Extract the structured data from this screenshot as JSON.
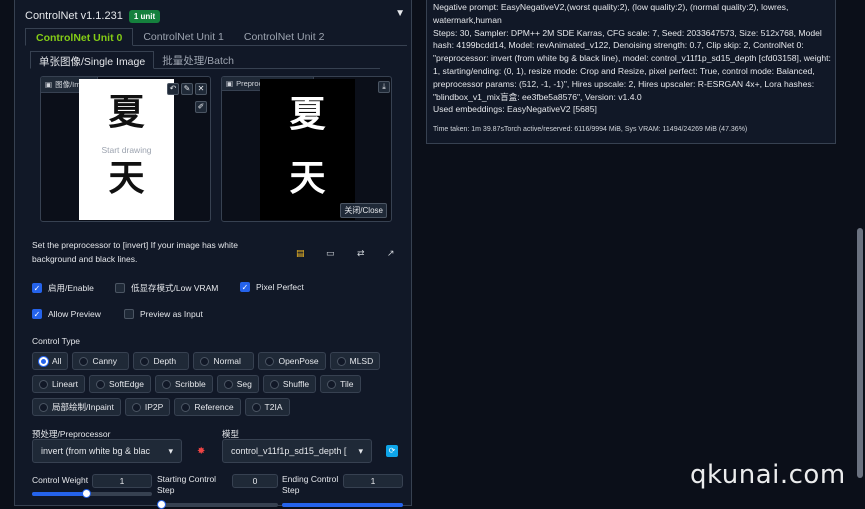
{
  "accordion": {
    "title": "ControlNet v1.1.231",
    "badge": "1 unit",
    "caret": "▼"
  },
  "unit_tabs": [
    "ControlNet Unit 0",
    "ControlNet Unit 1",
    "ControlNet Unit 2"
  ],
  "sub_tabs": [
    "单张图像/Single Image",
    "批量处理/Batch"
  ],
  "image_panel": {
    "label": "图像/Image",
    "overlay_text": "Start drawing",
    "char1": "夏",
    "char2": "天"
  },
  "preview_panel": {
    "label": "Preprocessor Preview",
    "close_label": "关闭/Close",
    "char1": "夏",
    "char2": "天"
  },
  "hint": "Set the preprocessor to [invert] If your image has white background and black lines.",
  "checks_row1": [
    {
      "label": "启用/Enable",
      "checked": true
    },
    {
      "label": "低显存模式/Low VRAM",
      "checked": false
    },
    {
      "label": "Pixel Perfect",
      "checked": true
    }
  ],
  "checks_row2": [
    {
      "label": "Allow Preview",
      "checked": true
    },
    {
      "label": "Preview as Input",
      "checked": false
    }
  ],
  "control_type": {
    "label": "Control Type",
    "row1": [
      "All",
      "Canny",
      "Depth",
      "Normal",
      "OpenPose",
      "MLSD"
    ],
    "row2": [
      "Lineart",
      "SoftEdge",
      "Scribble",
      "Seg",
      "Shuffle",
      "Tile"
    ],
    "row3": [
      "局部绘制/Inpaint",
      "IP2P",
      "Reference",
      "T2IA"
    ],
    "selected": "All"
  },
  "preprocessor": {
    "label": "预处理/Preprocessor",
    "value": "invert (from white bg & blac"
  },
  "model": {
    "label": "模型",
    "value": "control_v11f1p_sd15_depth ["
  },
  "control_weight": {
    "label": "Control Weight",
    "value": "1",
    "fraction": 0.45
  },
  "starting_step": {
    "label": "Starting Control Step",
    "value": "0"
  },
  "ending_step": {
    "label": "Ending Control Step",
    "value": "1"
  },
  "generation_info": "Negative prompt: EasyNegativeV2,(worst quality:2), (low quality:2), (normal quality:2), lowres, watermark,human\nSteps: 30, Sampler: DPM++ 2M SDE Karras, CFG scale: 7, Seed: 2033647573, Size: 512x768, Model hash: 4199bcdd14, Model: revAnimated_v122, Denoising strength: 0.7, Clip skip: 2, ControlNet 0: \"preprocessor: invert (from white bg & black line), model: control_v11f1p_sd15_depth [cfd03158], weight: 1, starting/ending: (0, 1), resize mode: Crop and Resize, pixel perfect: True, control mode: Balanced, preprocessor params: (512, -1, -1)\", Hires upscale: 2, Hires upscaler: R-ESRGAN 4x+, Lora hashes: \"blindbox_v1_mix盲盒: ee3fbe5a8576\", Version: v1.4.0\nUsed embeddings: EasyNegativeV2 [5685]",
  "time_taken": "Time taken: 1m 39.87sTorch active/reserved: 6116/9994 MiB, Sys VRAM: 11494/24269 MiB (47.36%)",
  "watermark": "qkunai.com"
}
